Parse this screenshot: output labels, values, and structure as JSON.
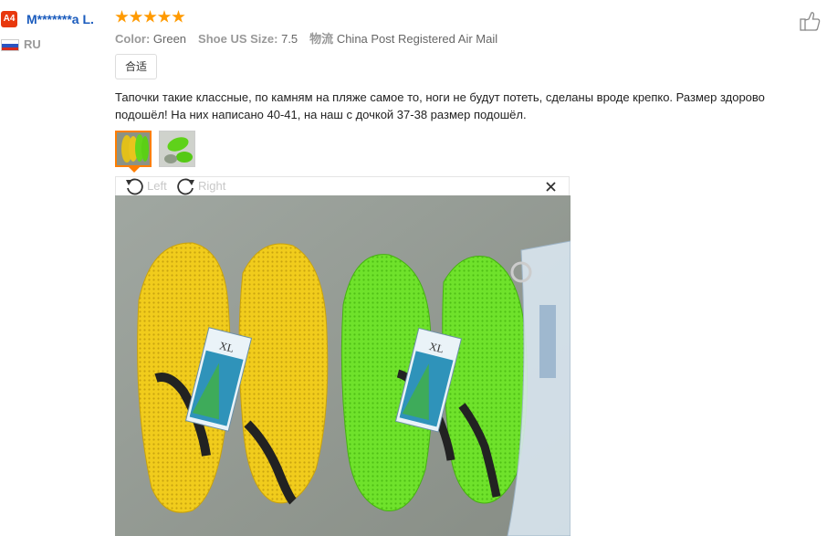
{
  "reviewer": {
    "level": "A4",
    "name": "M*******a L.",
    "country": "RU",
    "rating": 5
  },
  "attributes": [
    {
      "label": "Color:",
      "value": "Green"
    },
    {
      "label": "Shoe US Size:",
      "value": "7.5"
    },
    {
      "label": "物流",
      "value": "China Post Registered Air Mail"
    }
  ],
  "tag": "合适",
  "review_text": "Тапочки такие классные, по камням на пляже самое то, ноги не будут потеть, сделаны вроде крепко. Размер здорово подошёл! На них написано 40-41, на наш с дочкой 37-38 размер подошёл.",
  "viewer": {
    "rotate_left": "Left",
    "rotate_right": "Right",
    "tag_label": "XL"
  },
  "colors": {
    "accent": "#ff7e00",
    "star": "#ff9a00",
    "name": "#1a5bbd",
    "badge": "#e8380d"
  }
}
